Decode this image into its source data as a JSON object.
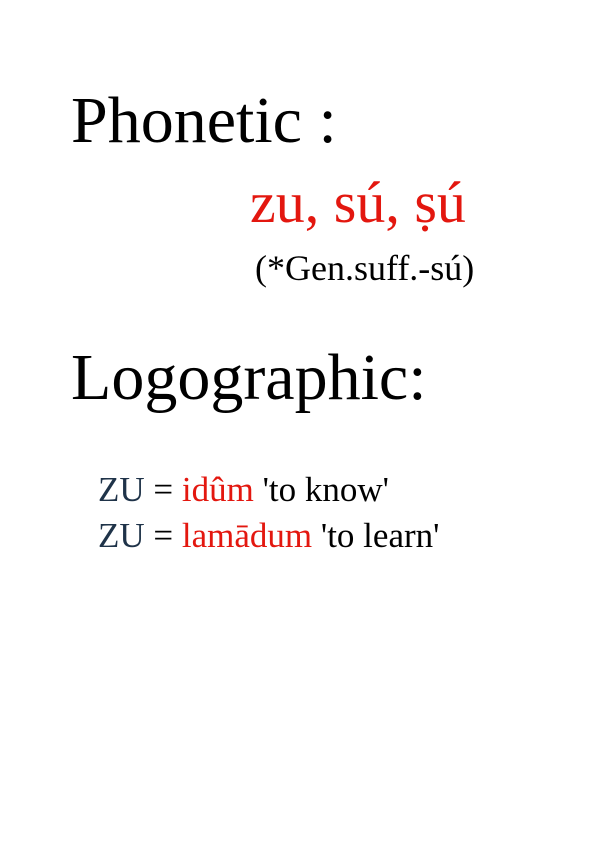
{
  "phonetic": {
    "heading": "Phonetic :",
    "values": "zu, sú, ṣú",
    "note": "(*Gen.suff.-sú)"
  },
  "logographic": {
    "heading": "Logographic:",
    "entries": [
      {
        "sign": "ZU",
        "equals": "=",
        "akkadian": "idûm",
        "gloss": "'to know'"
      },
      {
        "sign": "ZU",
        "equals": "=",
        "akkadian": "lamādum",
        "gloss": "'to learn'"
      }
    ]
  },
  "colors": {
    "highlight": "#e3170f",
    "sign": "#1f3349",
    "text": "#000000"
  }
}
